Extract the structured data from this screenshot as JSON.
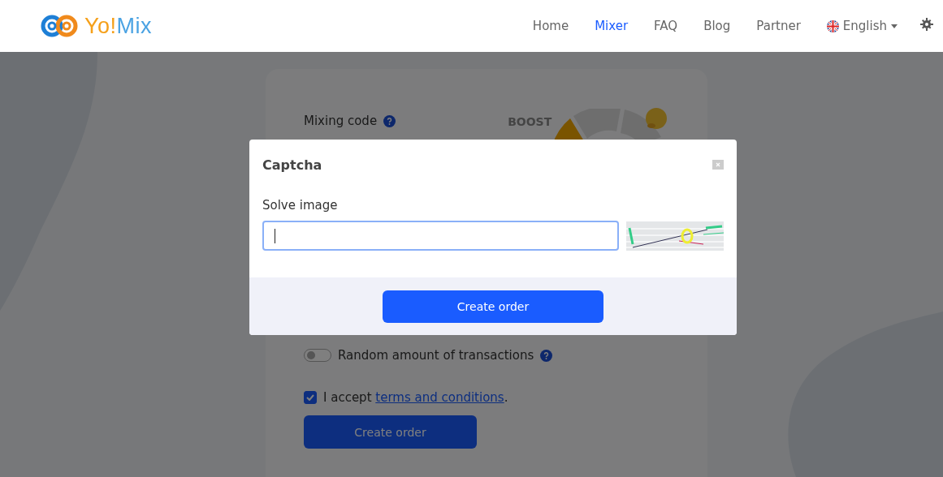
{
  "header": {
    "logo": {
      "parts": [
        {
          "text": "Yo!",
          "color": "#f5a01a"
        },
        {
          "text": "Mix",
          "color": "#4ba3e3"
        }
      ]
    },
    "nav": [
      {
        "label": "Home",
        "selected": false
      },
      {
        "label": "Mixer",
        "selected": true
      },
      {
        "label": "FAQ",
        "selected": false
      },
      {
        "label": "Blog",
        "selected": false
      },
      {
        "label": "Partner",
        "selected": false
      }
    ],
    "language": "English"
  },
  "form": {
    "mixing_code_label": "Mixing code",
    "boost_label": "BOOST",
    "random_toggle": {
      "label": "Random amount of transactions",
      "on": false
    },
    "accept": {
      "checked": true,
      "before": "I accept",
      "link": "terms and conditions",
      "after": "."
    },
    "button": "Create order"
  },
  "dialog": {
    "title": "Captcha",
    "label": "Solve image",
    "input": {
      "focused": true
    },
    "button": "Create order"
  }
}
